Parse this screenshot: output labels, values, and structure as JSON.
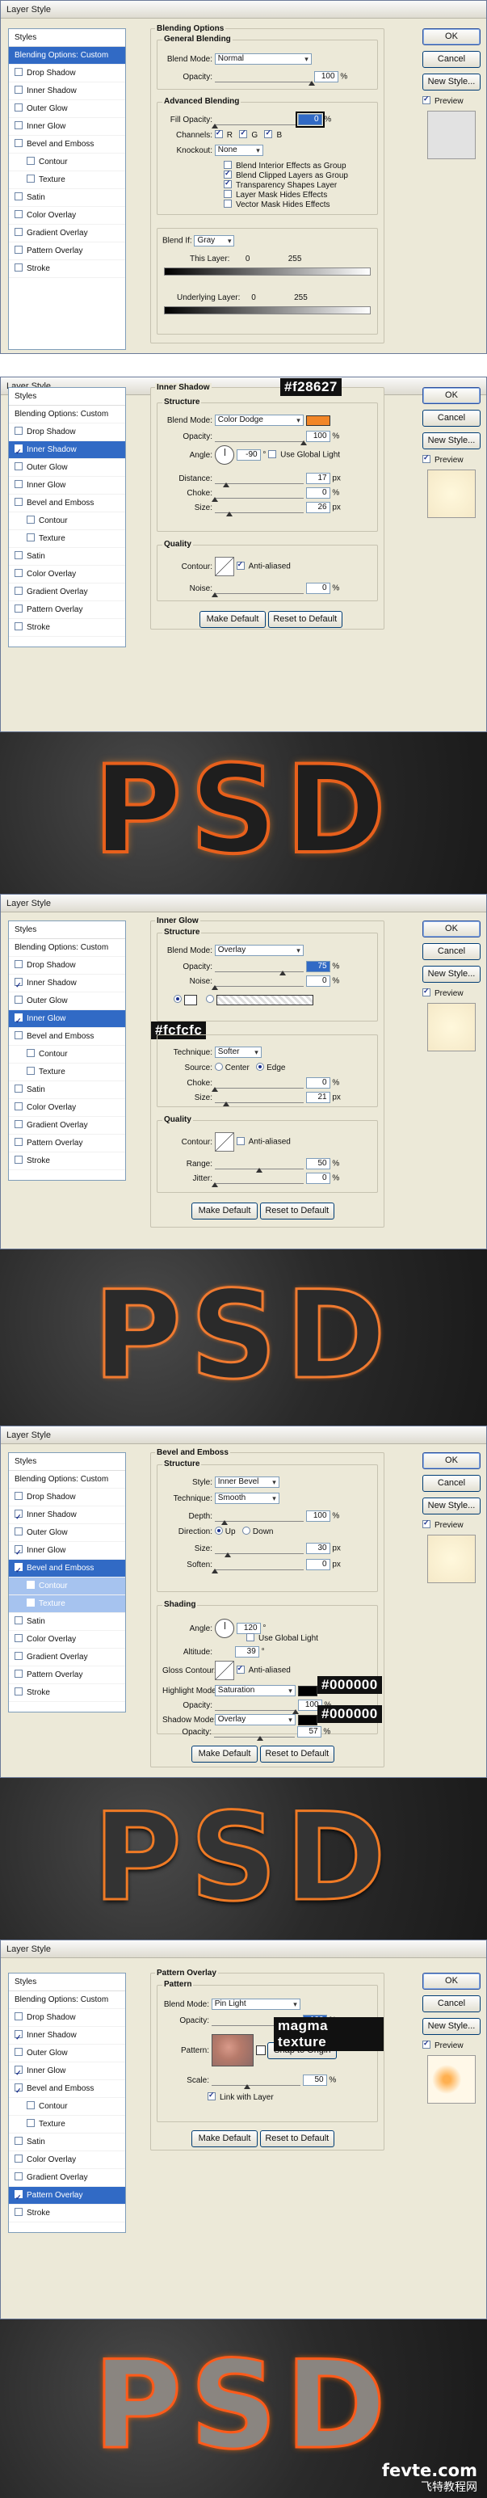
{
  "dialog_title": "Layer Style",
  "buttons": {
    "ok": "OK",
    "cancel": "Cancel",
    "new_style": "New Style...",
    "preview": "Preview"
  },
  "sidebar_items": [
    "Styles",
    "Blending Options: Custom",
    "Drop Shadow",
    "Inner Shadow",
    "Outer Glow",
    "Inner Glow",
    "Bevel and Emboss",
    "Contour",
    "Texture",
    "Satin",
    "Color Overlay",
    "Gradient Overlay",
    "Pattern Overlay",
    "Stroke"
  ],
  "panel1": {
    "title": "Blending Options",
    "general": {
      "title": "General Blending",
      "blend_mode_label": "Blend Mode:",
      "blend_mode": "Normal",
      "opacity_label": "Opacity:",
      "opacity": "100",
      "unit": "%"
    },
    "advanced": {
      "title": "Advanced Blending",
      "fill_label": "Fill Opacity:",
      "fill": "0",
      "unit": "%",
      "channels_label": "Channels:",
      "r": "R",
      "g": "G",
      "b": "B",
      "knockout_label": "Knockout:",
      "knockout": "None",
      "opts": [
        "Blend Interior Effects as Group",
        "Blend Clipped Layers as Group",
        "Transparency Shapes Layer",
        "Layer Mask Hides Effects",
        "Vector Mask Hides Effects"
      ]
    },
    "blend_if_label": "Blend If:",
    "blend_if": "Gray",
    "this_layer": "This Layer:",
    "underlying": "Underlying Layer:",
    "v0": "0",
    "v255": "255"
  },
  "panel2": {
    "title": "Inner Shadow",
    "structure": "Structure",
    "blend_mode_label": "Blend Mode:",
    "blend_mode": "Color Dodge",
    "opacity_label": "Opacity:",
    "opacity": "100",
    "angle_label": "Angle:",
    "angle": "-90",
    "global_light": "Use Global Light",
    "distance_label": "Distance:",
    "distance": "17",
    "choke_label": "Choke:",
    "choke": "0",
    "size_label": "Size:",
    "size": "26",
    "quality": "Quality",
    "contour_label": "Contour:",
    "anti": "Anti-aliased",
    "noise_label": "Noise:",
    "noise": "0",
    "make_default": "Make Default",
    "reset_default": "Reset to Default",
    "color_tag": "#f28627",
    "swatch": "#f28627"
  },
  "panel3": {
    "title": "Inner Glow",
    "structure": "Structure",
    "blend_mode_label": "Blend Mode:",
    "blend_mode": "Overlay",
    "opacity_label": "Opacity:",
    "opacity": "75",
    "noise_label": "Noise:",
    "noise": "0",
    "elements": "Elements",
    "technique_label": "Technique:",
    "technique": "Softer",
    "source_label": "Source:",
    "center": "Center",
    "edge": "Edge",
    "choke_label": "Choke:",
    "choke": "0",
    "size_label": "Size:",
    "size": "21",
    "quality": "Quality",
    "contour_label": "Contour:",
    "anti": "Anti-aliased",
    "range_label": "Range:",
    "range": "50",
    "jitter_label": "Jitter:",
    "jitter": "0",
    "make_default": "Make Default",
    "reset_default": "Reset to Default",
    "color_tag": "#fcfcfc",
    "swatch": "#fcfcfc"
  },
  "panel4": {
    "title": "Bevel and Emboss",
    "structure": "Structure",
    "style_label": "Style:",
    "style": "Inner Bevel",
    "technique_label": "Technique:",
    "technique": "Smooth",
    "depth_label": "Depth:",
    "depth": "100",
    "direction_label": "Direction:",
    "up": "Up",
    "down": "Down",
    "size_label": "Size:",
    "size": "30",
    "soften_label": "Soften:",
    "soften": "0",
    "shading": "Shading",
    "angle_label": "Angle:",
    "angle": "120",
    "global_light": "Use Global Light",
    "altitude_label": "Altitude:",
    "altitude": "39",
    "gloss_label": "Gloss Contour:",
    "anti": "Anti-aliased",
    "highlight_label": "Highlight Mode:",
    "highlight": "Saturation",
    "hl_opacity": "100",
    "shadow_label": "Shadow Mode:",
    "shadow": "Overlay",
    "sh_opacity": "57",
    "opacity_label": "Opacity:",
    "make_default": "Make Default",
    "reset_default": "Reset to Default",
    "tag1": "#000000",
    "tag2": "#000000"
  },
  "panel5": {
    "title": "Pattern Overlay",
    "pattern_title": "Pattern",
    "blend_mode_label": "Blend Mode:",
    "blend_mode": "Pin Light",
    "opacity_label": "Opacity:",
    "opacity": "100",
    "pattern_label": "Pattern:",
    "snap": "Snap to Origin",
    "scale_label": "Scale:",
    "scale": "50",
    "link": "Link with Layer",
    "make_default": "Make Default",
    "reset_default": "Reset to Default",
    "tag": "magma texture"
  },
  "units": {
    "pct": "%",
    "px": "px",
    "deg": "°"
  },
  "psd_text": "PSD",
  "watermark": "fevte.com",
  "watermark2": "飞特教程网"
}
